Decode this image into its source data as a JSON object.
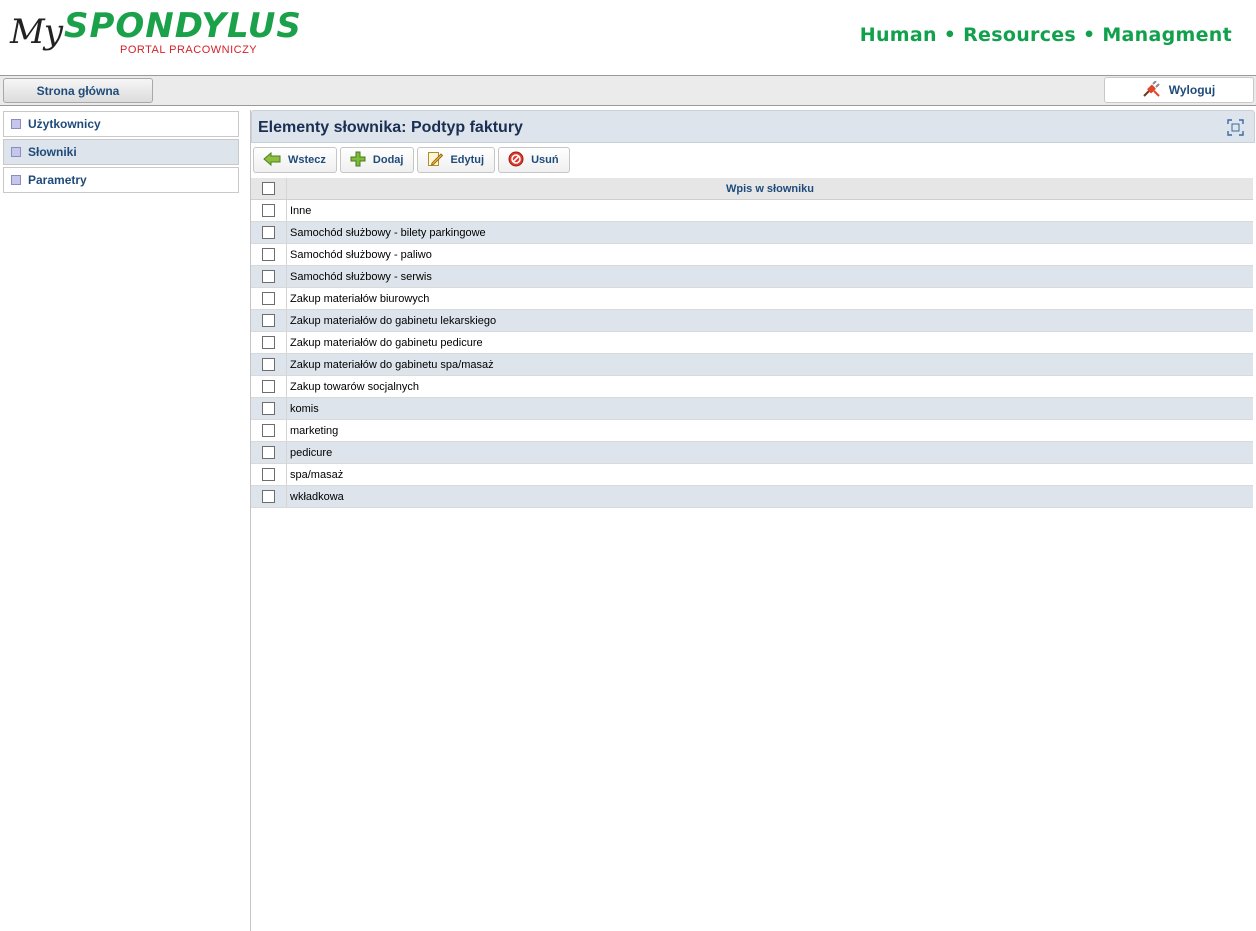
{
  "header": {
    "logo_my": "My",
    "logo_brand": "SPONDYLUS",
    "logo_sub": "PORTAL PRACOWNICZY",
    "tagline": "Human • Resources • Managment"
  },
  "nav": {
    "home_label": "Strona główna",
    "logout_label": "Wyloguj"
  },
  "sidebar": {
    "items": [
      {
        "label": "Użytkownicy",
        "active": false
      },
      {
        "label": "Słowniki",
        "active": true
      },
      {
        "label": "Parametry",
        "active": false
      }
    ]
  },
  "panel": {
    "title": "Elementy słownika: Podtyp faktury"
  },
  "toolbar": {
    "back_label": "Wstecz",
    "add_label": "Dodaj",
    "edit_label": "Edytuj",
    "delete_label": "Usuń"
  },
  "table": {
    "header": "Wpis w słowniku",
    "rows": [
      "Inne",
      "Samochód służbowy - bilety parkingowe",
      "Samochód służbowy - paliwo",
      "Samochód służbowy - serwis",
      "Zakup materiałów biurowych",
      "Zakup materiałów do gabinetu lekarskiego",
      "Zakup materiałów do gabinetu pedicure",
      "Zakup materiałów do gabinetu spa/masaż",
      "Zakup towarów socjalnych",
      "komis",
      "marketing",
      "pedicure",
      "spa/masaż",
      "wkładkowa"
    ]
  },
  "colors": {
    "brand_green": "#11a04c",
    "accent_red": "#d2232a",
    "link_blue": "#1f4b7a",
    "row_alt": "#dde4ec"
  }
}
